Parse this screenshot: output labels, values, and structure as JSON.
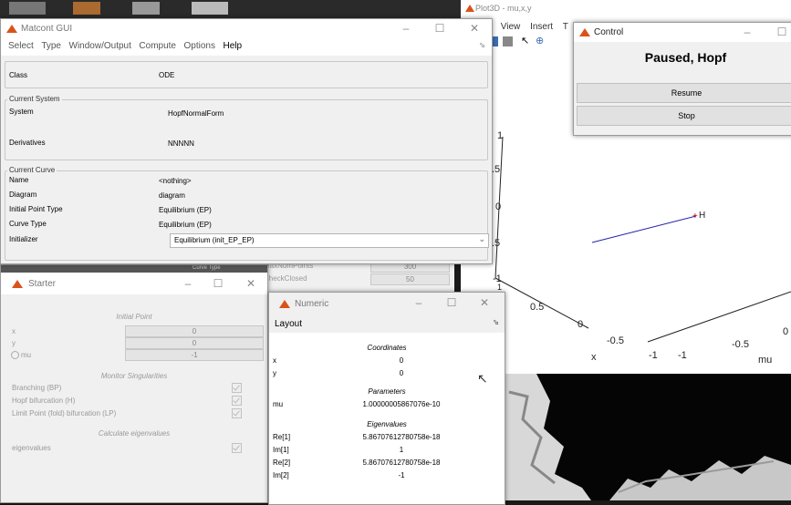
{
  "plot3d": {
    "title": "Plot3D - mu,x,y",
    "menu": [
      "it",
      "View",
      "Insert",
      "T"
    ],
    "axis_ticks_z": [
      "1",
      ".5",
      "0",
      ".5",
      "-1",
      "1"
    ],
    "axis_ticks_y": [
      "0.5",
      "0",
      "-0.5",
      "-1"
    ],
    "axis_ticks_mu": [
      "-1",
      "-0.5",
      "0"
    ],
    "axis_labels": {
      "x": "x",
      "mu": "mu"
    },
    "point_label": "H"
  },
  "matcont": {
    "title": "Matcont GUI",
    "menu": [
      "Select",
      "Type",
      "Window/Output",
      "Compute",
      "Options",
      "Help"
    ],
    "class_label": "Class",
    "class_value": "ODE",
    "system_section": "Current System",
    "system_label": "System",
    "system_value": "HopfNormalForm",
    "derivatives_label": "Derivatives",
    "derivatives_value": "NNNNN",
    "curve_section": "Current Curve",
    "rows": [
      {
        "label": "Name",
        "value": "<nothing>"
      },
      {
        "label": "Diagram",
        "value": "diagram"
      },
      {
        "label": "Initial Point Type",
        "value": "Equilibrium (EP)"
      },
      {
        "label": "Curve Type",
        "value": "Equilibrium (EP)"
      }
    ],
    "initializer_label": "Initializer",
    "initializer_value": "Equilibrium (init_EP_EP)"
  },
  "control": {
    "title": "Control",
    "status": "Paused, Hopf",
    "resume_label": "Resume",
    "stop_label": "Stop"
  },
  "starter": {
    "title": "Starter",
    "behind_text": "Curve Type",
    "initial_point": "Initial Point",
    "vars": [
      {
        "label": "x",
        "value": "0"
      },
      {
        "label": "y",
        "value": "0"
      },
      {
        "label": "mu",
        "value": "-1"
      }
    ],
    "monitor": "Monitor Singularities",
    "singularities": [
      "Branching (BP)",
      "Hopf bifurcation (H)",
      "Limit Point (fold) bifurcation (LP)"
    ],
    "calc_eig": "Calculate eigenvalues",
    "eig_label": "eigenvalues"
  },
  "cont_partial": {
    "maxnumpoints_label": "MaxNumPoints",
    "maxnumpoints_value": "300",
    "checkclosed_label": "CheckClosed",
    "checkclosed_value": "50"
  },
  "numeric": {
    "title": "Numeric",
    "layout_label": "Layout",
    "coords_header": "Coordinates",
    "coords": [
      {
        "label": "x",
        "value": "0"
      },
      {
        "label": "y",
        "value": "0"
      }
    ],
    "params_header": "Parameters",
    "params": [
      {
        "label": "mu",
        "value": "1.00000005867076e-10"
      }
    ],
    "eig_header": "Eigenvalues",
    "eigs": [
      {
        "label": "Re[1]",
        "value": "5.86707612780758e-18"
      },
      {
        "label": "Im[1]",
        "value": "1"
      },
      {
        "label": "Re[2]",
        "value": "5.86707612780758e-18"
      },
      {
        "label": "Im[2]",
        "value": "-1"
      }
    ]
  },
  "colors": {
    "matlab_icon": "#d95319",
    "curve_line": "#2222aa",
    "hopf_marker": "#cc0000"
  }
}
